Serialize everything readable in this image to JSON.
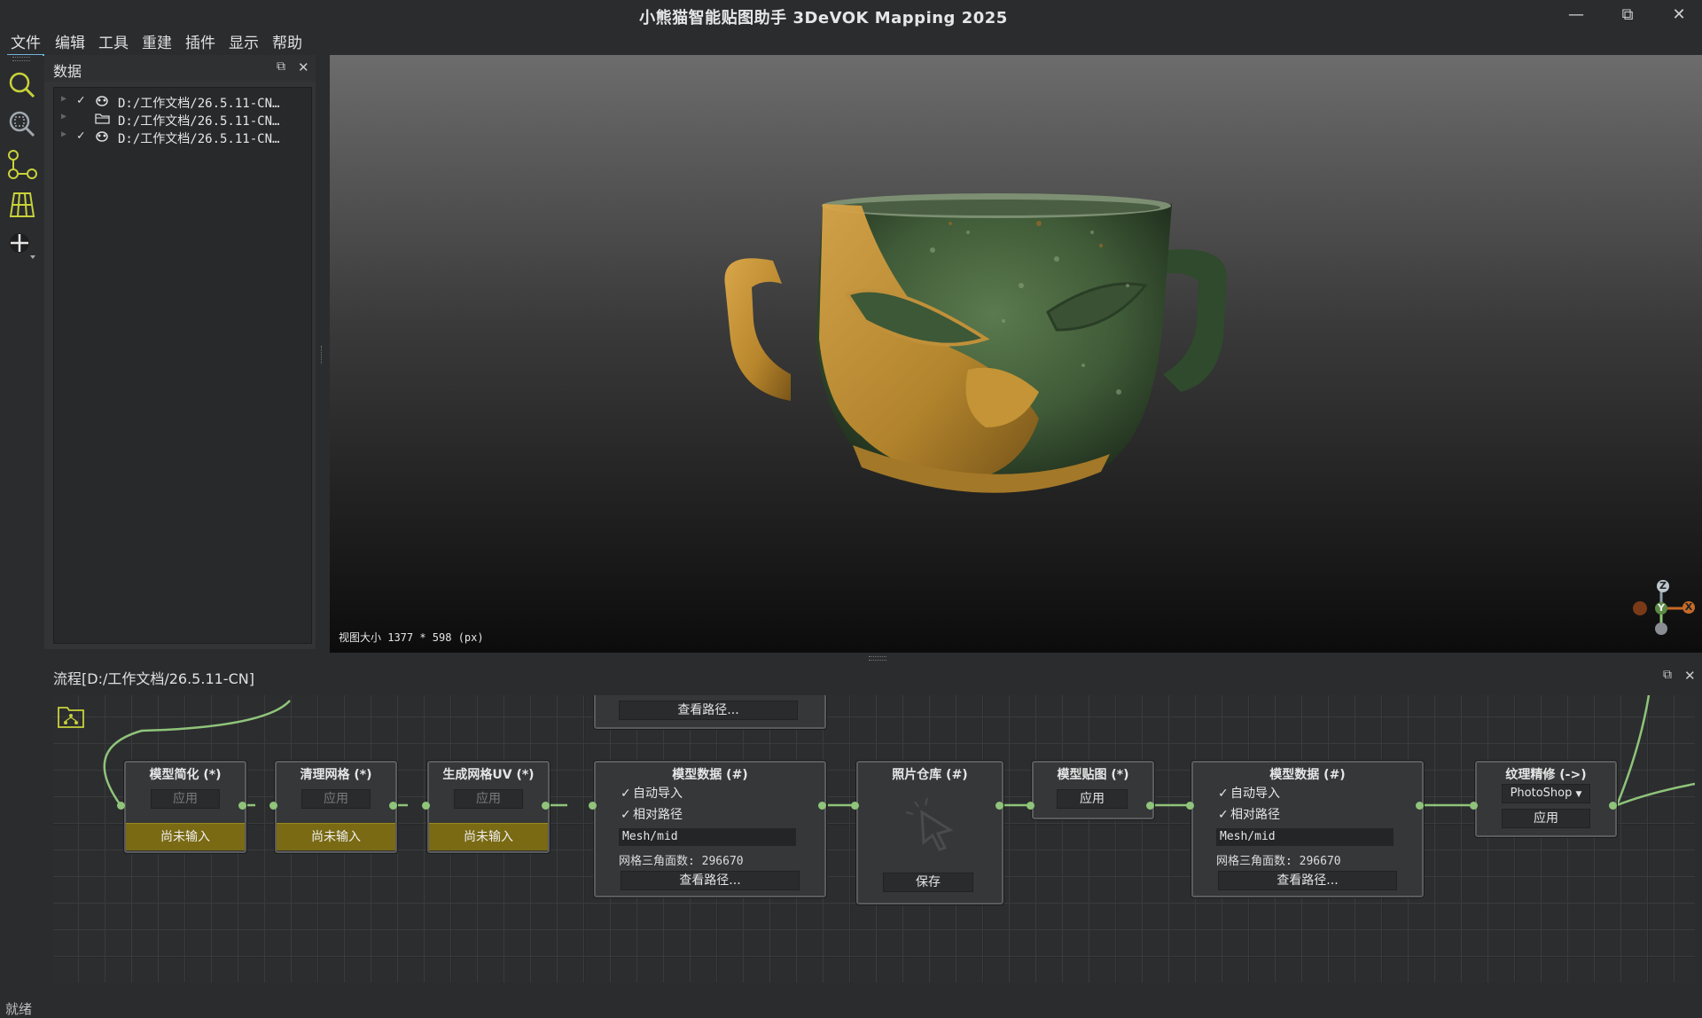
{
  "window": {
    "title": "小熊猫智能贴图助手 3DeVOK Mapping 2025",
    "minimize": "—",
    "restore": "⧉",
    "close": "✕"
  },
  "menu": [
    "文件",
    "编辑",
    "工具",
    "重建",
    "插件",
    "显示",
    "帮助"
  ],
  "toolbar": [
    "search-zoom-icon",
    "zoom-region-icon",
    "pick-points-icon",
    "grid-mesh-icon",
    "move-cross-icon"
  ],
  "data_panel": {
    "title": "数据",
    "float_icon": "⧉",
    "close_icon": "✕",
    "items": [
      {
        "checked": "✓",
        "icon": "mesh-icon",
        "label": "D:/工作文档/26.5.11-CN…"
      },
      {
        "checked": "",
        "icon": "folder-icon",
        "label": "D:/工作文档/26.5.11-CN…"
      },
      {
        "checked": "✓",
        "icon": "mesh-icon",
        "label": "D:/工作文档/26.5.11-CN…"
      }
    ]
  },
  "viewport": {
    "size_label": "视图大小 1377 * 598 (px)",
    "axes": {
      "z": "Z",
      "y": "Y",
      "x": "X"
    }
  },
  "flow_panel": {
    "title": "流程[D:/工作文档/26.5.11-CN]",
    "float_icon": "⧉",
    "close_icon": "✕",
    "top_node_button": "查看路径...",
    "nodes": {
      "simplify": {
        "title": "模型简化 (*)",
        "apply": "应用",
        "status": "尚未输入"
      },
      "clean": {
        "title": "清理网格 (*)",
        "apply": "应用",
        "status": "尚未输入"
      },
      "uv": {
        "title": "生成网格UV (*)",
        "apply": "应用",
        "status": "尚未输入"
      },
      "model_data_1": {
        "title": "模型数据 (#)",
        "auto_import": "自动导入",
        "relative_path": "相对路径",
        "mesh": "Mesh/mid",
        "triangles": "网格三角面数: 296670",
        "view_path": "查看路径..."
      },
      "photos": {
        "title": "照片仓库 (#)",
        "save": "保存"
      },
      "texture": {
        "title": "模型贴图 (*)",
        "apply": "应用"
      },
      "model_data_2": {
        "title": "模型数据 (#)",
        "auto_import": "自动导入",
        "relative_path": "相对路径",
        "mesh": "Mesh/mid",
        "triangles": "网格三角面数: 296670",
        "view_path": "查看路径..."
      },
      "refine": {
        "title": "纹理精修 (->)",
        "app": "PhotoShop",
        "apply": "应用"
      }
    }
  },
  "status": "就绪",
  "colors": {
    "accent": "#8fc47a",
    "warn": "#7a6a14",
    "bg": "#2b2c2e"
  }
}
